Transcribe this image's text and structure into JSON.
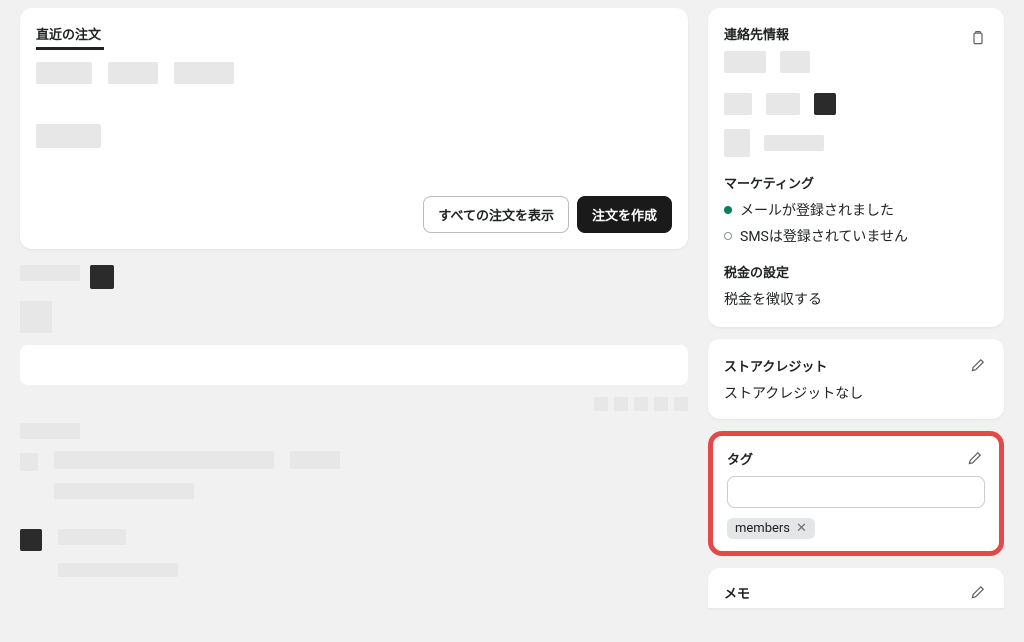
{
  "main": {
    "recent_orders": {
      "title": "直近の注文",
      "view_all_button": "すべての注文を表示",
      "create_order_button": "注文を作成"
    }
  },
  "sidebar": {
    "contact": {
      "title": "連絡先情報",
      "clipboard_icon": "clipboard-icon"
    },
    "marketing": {
      "title": "マーケティング",
      "email_status": "メールが登録されました",
      "sms_status": "SMSは登録されていません"
    },
    "tax": {
      "title": "税金の設定",
      "collect": "税金を徴収する"
    },
    "store_credit": {
      "title": "ストアクレジット",
      "none": "ストアクレジットなし"
    },
    "tags": {
      "title": "タグ",
      "input_placeholder": "",
      "items": [
        "members"
      ]
    },
    "memo": {
      "title": "メモ"
    }
  }
}
